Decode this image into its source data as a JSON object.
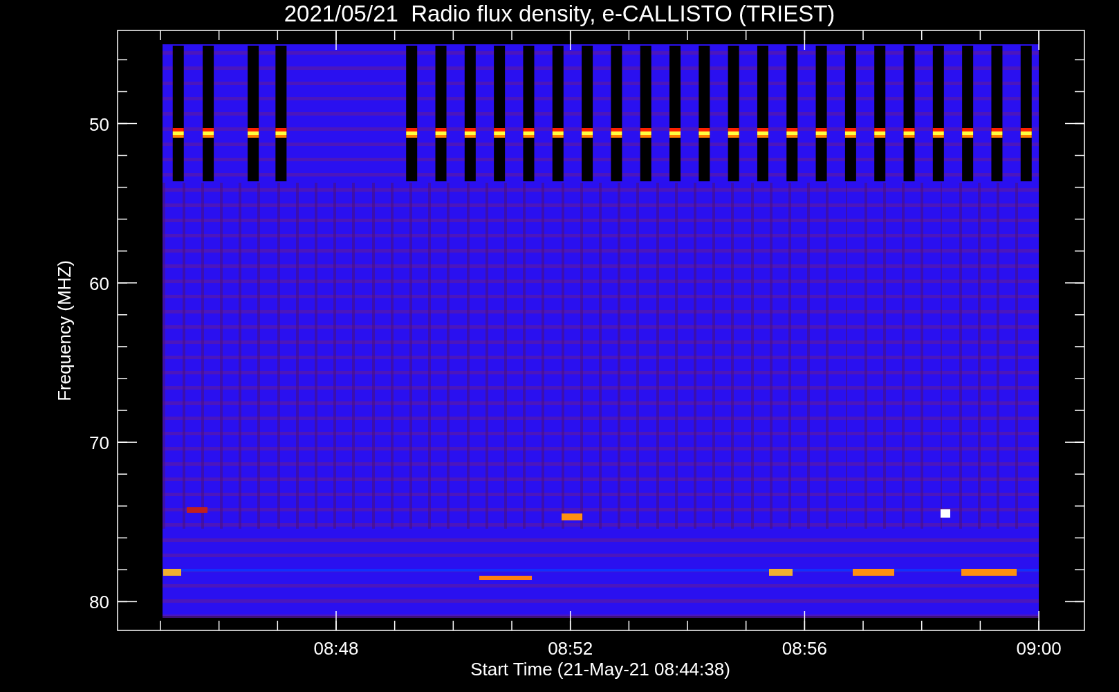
{
  "title": "2021/05/21  Radio flux density, e-CALLISTO (TRIEST)",
  "y_axis": {
    "label": "Frequency (MHZ)",
    "ticks": [
      "50",
      "60",
      "70",
      "80"
    ]
  },
  "x_axis": {
    "label": "Start Time (21-May-21 08:44:38)",
    "ticks": [
      "08:48",
      "08:52",
      "08:56",
      "09:00"
    ]
  }
}
